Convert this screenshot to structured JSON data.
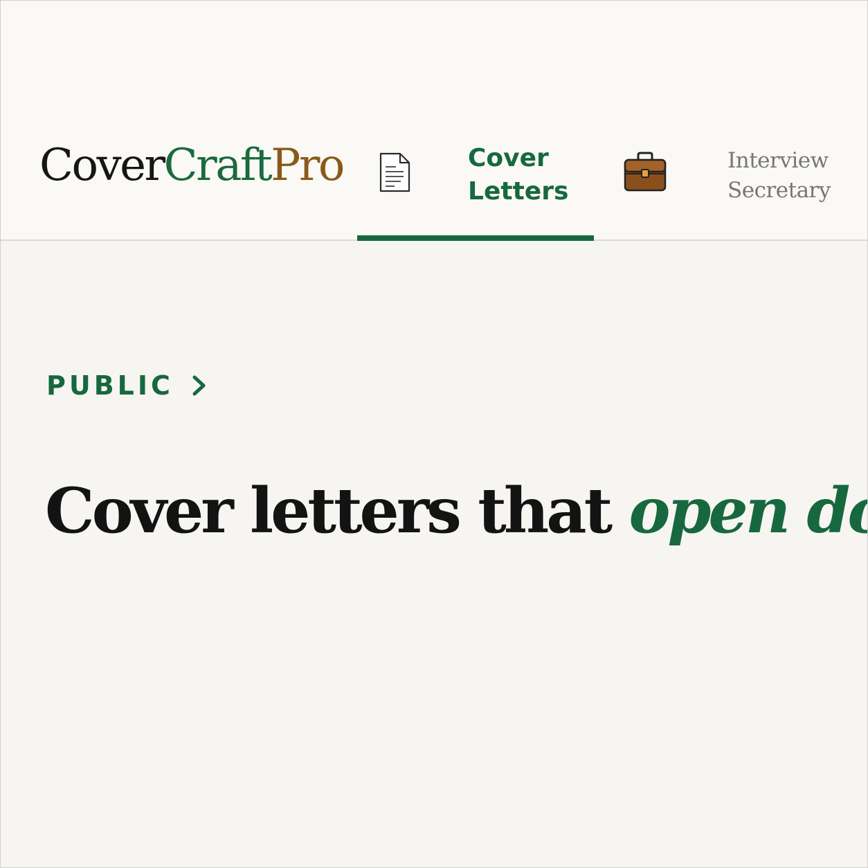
{
  "brand": {
    "part1": "Cover",
    "part2": "Craft",
    "part3": "Pro",
    "colors": {
      "part1": "#161616",
      "part2": "#1a6a3e",
      "part3": "#8a5a1a"
    }
  },
  "nav": {
    "tabs": [
      {
        "icon": "document-icon",
        "label": "Cover\nLetters",
        "active": true
      },
      {
        "icon": "briefcase-icon",
        "label": "Interview\nSecretary",
        "active": false
      }
    ]
  },
  "breadcrumb": {
    "label": "PUBLIC",
    "icon": "chevron-right-icon"
  },
  "hero": {
    "title_main": "Cover letters that",
    "title_accent": "open doors"
  },
  "colors": {
    "accent": "#17683e",
    "background": "#f6f5f1",
    "header_background": "#faf9f6",
    "inactive_text": "#777772"
  }
}
